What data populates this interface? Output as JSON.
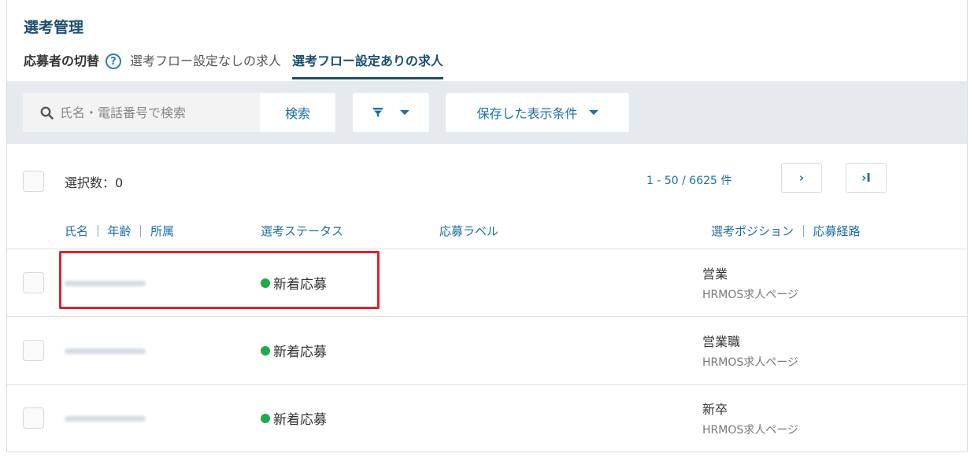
{
  "header": {
    "title": "選考管理",
    "switch_label": "応募者の切替",
    "help_icon": "?",
    "tabs": [
      {
        "label": "選考フロー設定なしの求人",
        "active": false
      },
      {
        "label": "選考フロー設定ありの求人",
        "active": true
      }
    ]
  },
  "toolbar": {
    "search_placeholder": "氏名・電話番号で検索",
    "search_button": "検索",
    "saved_conditions": "保存した表示条件"
  },
  "list": {
    "selected_label": "選択数：0",
    "pager_text": "1 - 50 / 6625 件",
    "pager_next": "›",
    "pager_last": "›I"
  },
  "columns": {
    "name": "氏名 ｜ 年齢 ｜ 所属",
    "status": "選考ステータス",
    "label": "応募ラベル",
    "position": "選考ポジション ｜ 応募経路"
  },
  "rows": [
    {
      "status": "新着応募",
      "position": "営業",
      "route": "HRMOS求人ページ"
    },
    {
      "status": "新着応募",
      "position": "営業職",
      "route": "HRMOS求人ページ"
    },
    {
      "status": "新着応募",
      "position": "新卒",
      "route": "HRMOS求人ページ"
    }
  ],
  "colors": {
    "accent": "#1c6ea4",
    "title": "#1c4f6e",
    "status_new": "#1fab4a",
    "highlight": "#e0202e",
    "toolbar_bg": "#e4eaee"
  }
}
